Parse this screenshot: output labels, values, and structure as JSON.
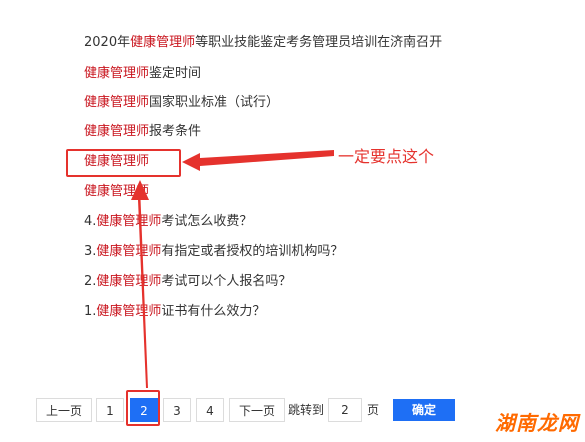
{
  "articles": [
    {
      "prefix": "2020年",
      "keyword": "健康管理师",
      "suffix": "等职业技能鉴定考务管理员培训在济南召开"
    },
    {
      "prefix": "",
      "keyword": "健康管理师",
      "suffix": "鉴定时间"
    },
    {
      "prefix": "",
      "keyword": "健康管理师",
      "suffix": "国家职业标准（试行）"
    },
    {
      "prefix": "",
      "keyword": "健康管理师",
      "suffix": "报考条件"
    },
    {
      "prefix": "",
      "keyword": "健康管理师",
      "suffix": ""
    },
    {
      "prefix": "",
      "keyword": "健康管理师",
      "suffix": ""
    },
    {
      "prefix": "4.",
      "keyword": "健康管理师",
      "suffix": "考试怎么收费？"
    },
    {
      "prefix": "3.",
      "keyword": "健康管理师",
      "suffix": "有指定或者授权的培训机构吗？"
    },
    {
      "prefix": "2.",
      "keyword": "健康管理师",
      "suffix": "考试可以个人报名吗？"
    },
    {
      "prefix": "1.",
      "keyword": "健康管理师",
      "suffix": "证书有什么效力？"
    }
  ],
  "pagination": {
    "prev_label": "上一页",
    "pages": [
      "1",
      "2",
      "3",
      "4"
    ],
    "current_page": "2",
    "next_label": "下一页",
    "jump_label": "跳转到",
    "jump_value": "2",
    "page_unit": "页",
    "confirm_label": "确定"
  },
  "annotation": {
    "text": "一定要点这个",
    "color": "#e5322d"
  },
  "watermark": "湖南龙网",
  "colors": {
    "keyword": "#c9151e",
    "accent": "#1e6ff5"
  }
}
